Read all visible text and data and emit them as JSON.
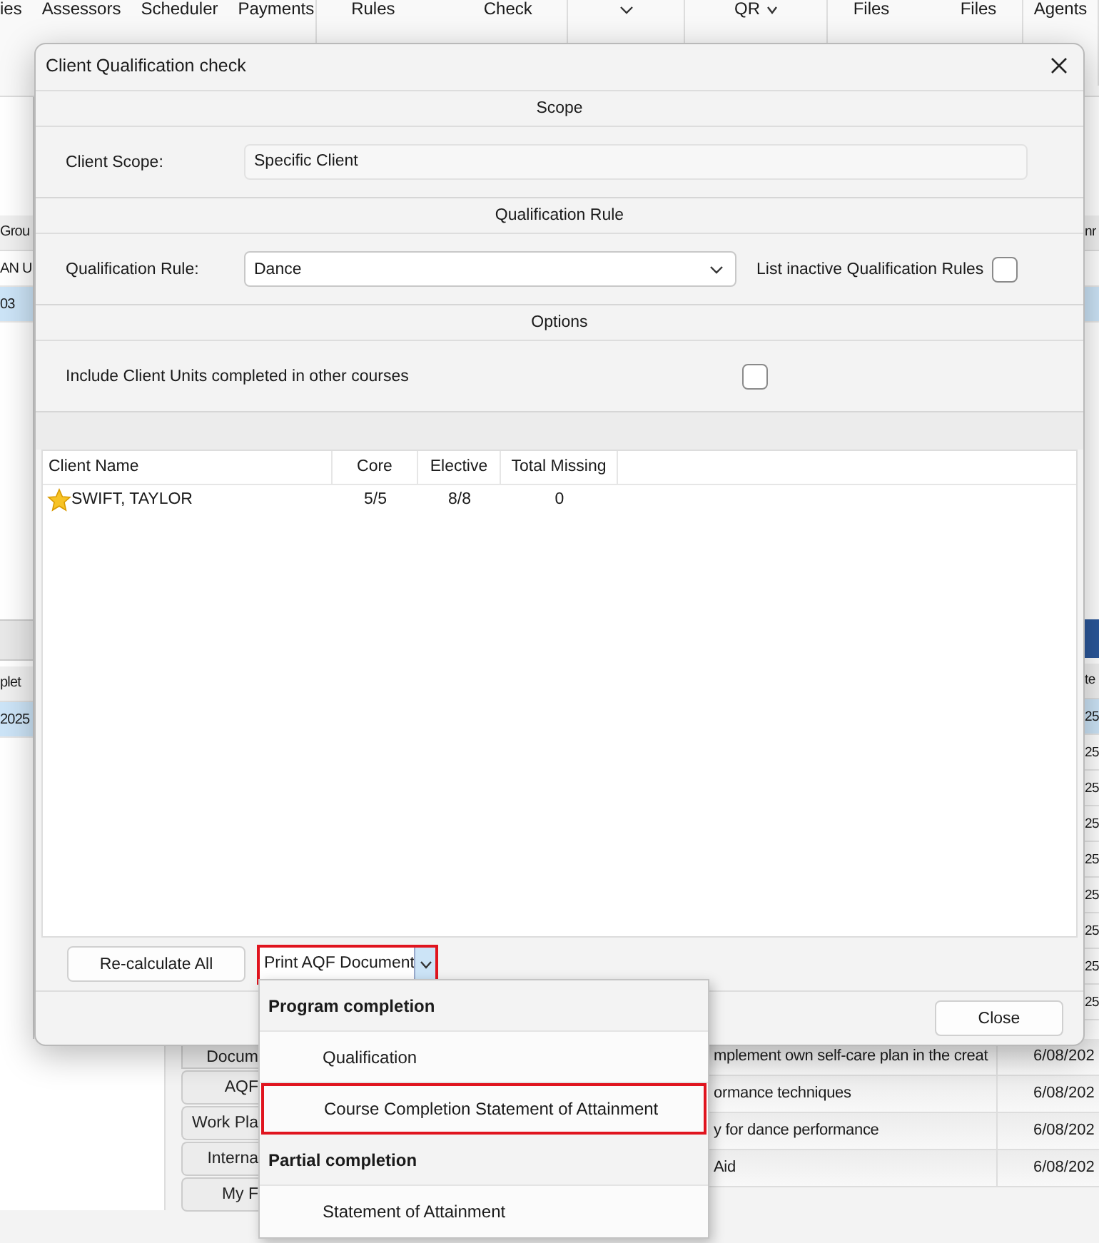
{
  "ribbon": {
    "groups": [
      {
        "items": [
          {
            "label": "ies",
            "has_menu": false
          },
          {
            "label": "Assessors",
            "has_menu": false
          },
          {
            "label": "Scheduler",
            "has_menu": false
          },
          {
            "label": "Payments",
            "has_menu": false
          }
        ]
      },
      {
        "items": [
          {
            "label": "Rules",
            "has_menu": false
          },
          {
            "label": "Check",
            "has_menu": false
          }
        ]
      },
      {
        "items": [
          {
            "has_menu": true
          }
        ]
      },
      {
        "items": [
          {
            "label": "QR",
            "has_menu": true
          }
        ]
      },
      {
        "items": [
          {
            "label": "Files",
            "has_menu": false
          },
          {
            "label": "Files",
            "has_menu": false
          }
        ]
      },
      {
        "items": [
          {
            "label": "Agents",
            "has_menu": false
          }
        ]
      }
    ]
  },
  "left_pane": {
    "upper_table": {
      "header": "Grou",
      "rows": [
        {
          "text": "AN U",
          "selected": false
        },
        {
          "text": "03",
          "selected": true
        }
      ]
    },
    "lower_table": {
      "header": "plet",
      "rows": [
        {
          "text": "2025",
          "selected": true
        }
      ]
    }
  },
  "right_pane": {
    "upper_table": {
      "header": "nr",
      "rows": [
        {
          "selected": false
        },
        {
          "selected": true
        }
      ]
    },
    "lower_table": {
      "header": "te",
      "rows": [
        {
          "text": "25",
          "selected": true
        },
        {
          "text": "25",
          "selected": false
        },
        {
          "text": "25",
          "selected": false
        },
        {
          "text": "25",
          "selected": false
        },
        {
          "text": "25",
          "selected": false
        },
        {
          "text": "25",
          "selected": false
        },
        {
          "text": "25",
          "selected": false
        },
        {
          "text": "25",
          "selected": false
        },
        {
          "text": "25",
          "selected": false
        }
      ]
    }
  },
  "side_buttons": [
    "Docum",
    "AQF",
    "Work Pla",
    "Interna",
    "My F"
  ],
  "units_table": {
    "rows": [
      {
        "description": "mplement own self-care plan in the creat",
        "date": "6/08/202"
      },
      {
        "description": "ormance techniques",
        "date": "6/08/202"
      },
      {
        "description": "y for dance performance",
        "date": "6/08/202"
      },
      {
        "description": "Aid",
        "date": "6/08/202"
      }
    ]
  },
  "dialog": {
    "title": "Client Qualification check",
    "scope": {
      "heading": "Scope",
      "label": "Client Scope:",
      "value": "Specific Client"
    },
    "qualification_rule": {
      "heading": "Qualification Rule",
      "label": "Qualification Rule:",
      "value": "Dance",
      "inactive_label": "List inactive Qualification Rules",
      "inactive_checked": false
    },
    "options": {
      "heading": "Options",
      "include_label": "Include Client Units completed in other courses",
      "include_checked": false
    },
    "results": {
      "columns": [
        "Client Name",
        "Core",
        "Elective",
        "Total Missing"
      ],
      "rows": [
        {
          "name": "SWIFT, TAYLOR",
          "starred": true,
          "core": "5/5",
          "elective": "8/8",
          "total_missing": "0"
        }
      ]
    },
    "recalculate_button": "Re-calculate All",
    "print_button": {
      "label": "Print AQF Document",
      "highlighted": true
    },
    "close_button": "Close"
  },
  "print_menu": {
    "items": [
      {
        "kind": "header",
        "label": "Program completion",
        "highlighted": false
      },
      {
        "kind": "item",
        "label": "Qualification",
        "highlighted": false
      },
      {
        "kind": "item",
        "label": "Course Completion Statement of Attainment",
        "highlighted": true
      },
      {
        "kind": "header",
        "label": "Partial completion",
        "highlighted": false
      },
      {
        "kind": "item",
        "label": "Statement of Attainment",
        "highlighted": false
      }
    ]
  }
}
